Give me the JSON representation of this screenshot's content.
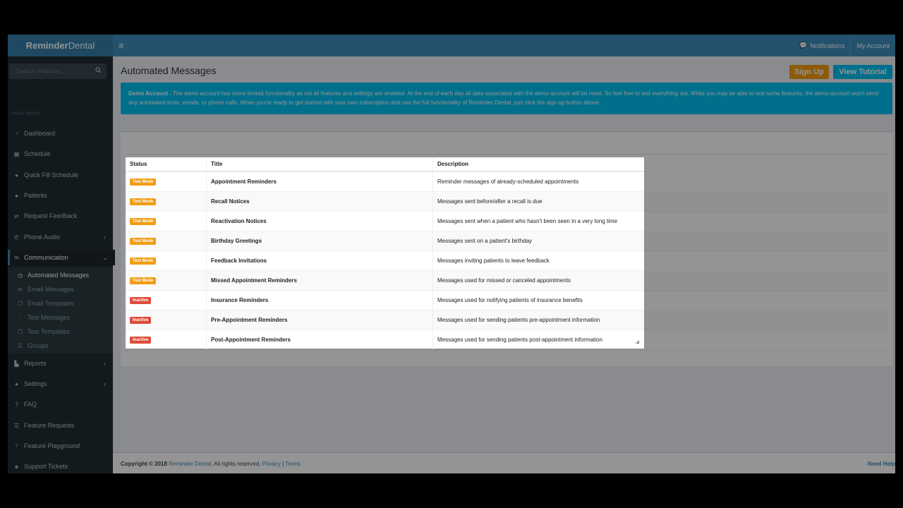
{
  "app": {
    "brand_bold": "Reminder",
    "brand_rest": "Dental"
  },
  "topnav": {
    "notifications": "Notifications",
    "account": "My Account"
  },
  "sidebar": {
    "search_placeholder": "Search Patients...",
    "menu_title": "MAIN MENU",
    "items": [
      {
        "label": "Dashboard",
        "icon": "dashboard-icon"
      },
      {
        "label": "Schedule",
        "icon": "calendar-icon"
      },
      {
        "label": "Quick Fill Schedule",
        "icon": "user-icon"
      },
      {
        "label": "Patients",
        "icon": "users-icon"
      },
      {
        "label": "Request Feedback",
        "icon": "retweet-icon"
      },
      {
        "label": "Phone Audio",
        "icon": "phone-icon"
      },
      {
        "label": "Communication",
        "icon": "comments-icon"
      }
    ],
    "sub_items": [
      {
        "label": "Automated Messages",
        "icon": "clock-icon"
      },
      {
        "label": "Email Messages",
        "icon": "envelope-icon"
      },
      {
        "label": "Email Templates",
        "icon": "copy-icon"
      },
      {
        "label": "Text Messages",
        "icon": "comment-icon"
      },
      {
        "label": "Text Templates",
        "icon": "copy-icon"
      },
      {
        "label": "Groups",
        "icon": "list-icon"
      }
    ],
    "bottom_items": [
      {
        "label": "Reports",
        "icon": "chart-icon"
      },
      {
        "label": "Settings",
        "icon": "wrench-icon"
      },
      {
        "label": "FAQ",
        "icon": "question-icon"
      },
      {
        "label": "Feature Requests",
        "icon": "list-icon"
      },
      {
        "label": "Feature Playground",
        "icon": "wand-icon"
      },
      {
        "label": "Support Tickets",
        "icon": "ticket-icon"
      }
    ]
  },
  "main": {
    "title": "Automated Messages",
    "signup_label": "Sign Up",
    "tutorial_label": "View Tutorial",
    "alert_strong": "Demo Account",
    "alert_text": " - The demo account has some limited functionality as not all features and settings are enabled. At the end of each day all data associated with the demo account will be reset. So feel free to test everything out. While you may be able to test some features, the demo account won't send any automated texts, emails, or phone calls. When you're ready to get started with your own subscription and use the full functionality of Reminder Dental, just click the sign up button above."
  },
  "table": {
    "headers": [
      "Status",
      "Title",
      "Description"
    ],
    "rows": [
      {
        "status": "Test Mode",
        "title": "Appointment Reminders",
        "description": "Reminder messages of already-scheduled appointments"
      },
      {
        "status": "Test Mode",
        "title": "Recall Notices",
        "description": "Messages sent before/after a recall is due"
      },
      {
        "status": "Test Mode",
        "title": "Reactivation Notices",
        "description": "Messages sent when a patient who hasn't been seen in a very long time"
      },
      {
        "status": "Test Mode",
        "title": "Birthday Greetings",
        "description": "Messages sent on a patient's birthday"
      },
      {
        "status": "Test Mode",
        "title": "Feedback Invitations",
        "description": "Messages inviting patients to leave feedback"
      },
      {
        "status": "Test Mode",
        "title": "Missed Appointment Reminders",
        "description": "Messages used for missed or canceled appointments"
      },
      {
        "status": "Inactive",
        "title": "Insurance Reminders",
        "description": "Messages used for notifying patients of insurance benefits"
      },
      {
        "status": "Inactive",
        "title": "Pre-Appointment Reminders",
        "description": "Messages used for sending patients pre-appointment information"
      },
      {
        "status": "Inactive",
        "title": "Post-Appointment Reminders",
        "description": "Messages used for sending patients post-appointment information"
      }
    ]
  },
  "footer": {
    "copyright": "Copyright © 2018 ",
    "company": "Reminder Dental",
    "rights": ". All rights reserved. ",
    "privacy": "Privacy",
    "divider": " | ",
    "terms": "Terms",
    "help": "Need Help"
  },
  "colors": {
    "test_mode": "#f39c12",
    "inactive": "#dd4b39",
    "header": "#3c8dbc",
    "sidebar": "#222d32"
  }
}
